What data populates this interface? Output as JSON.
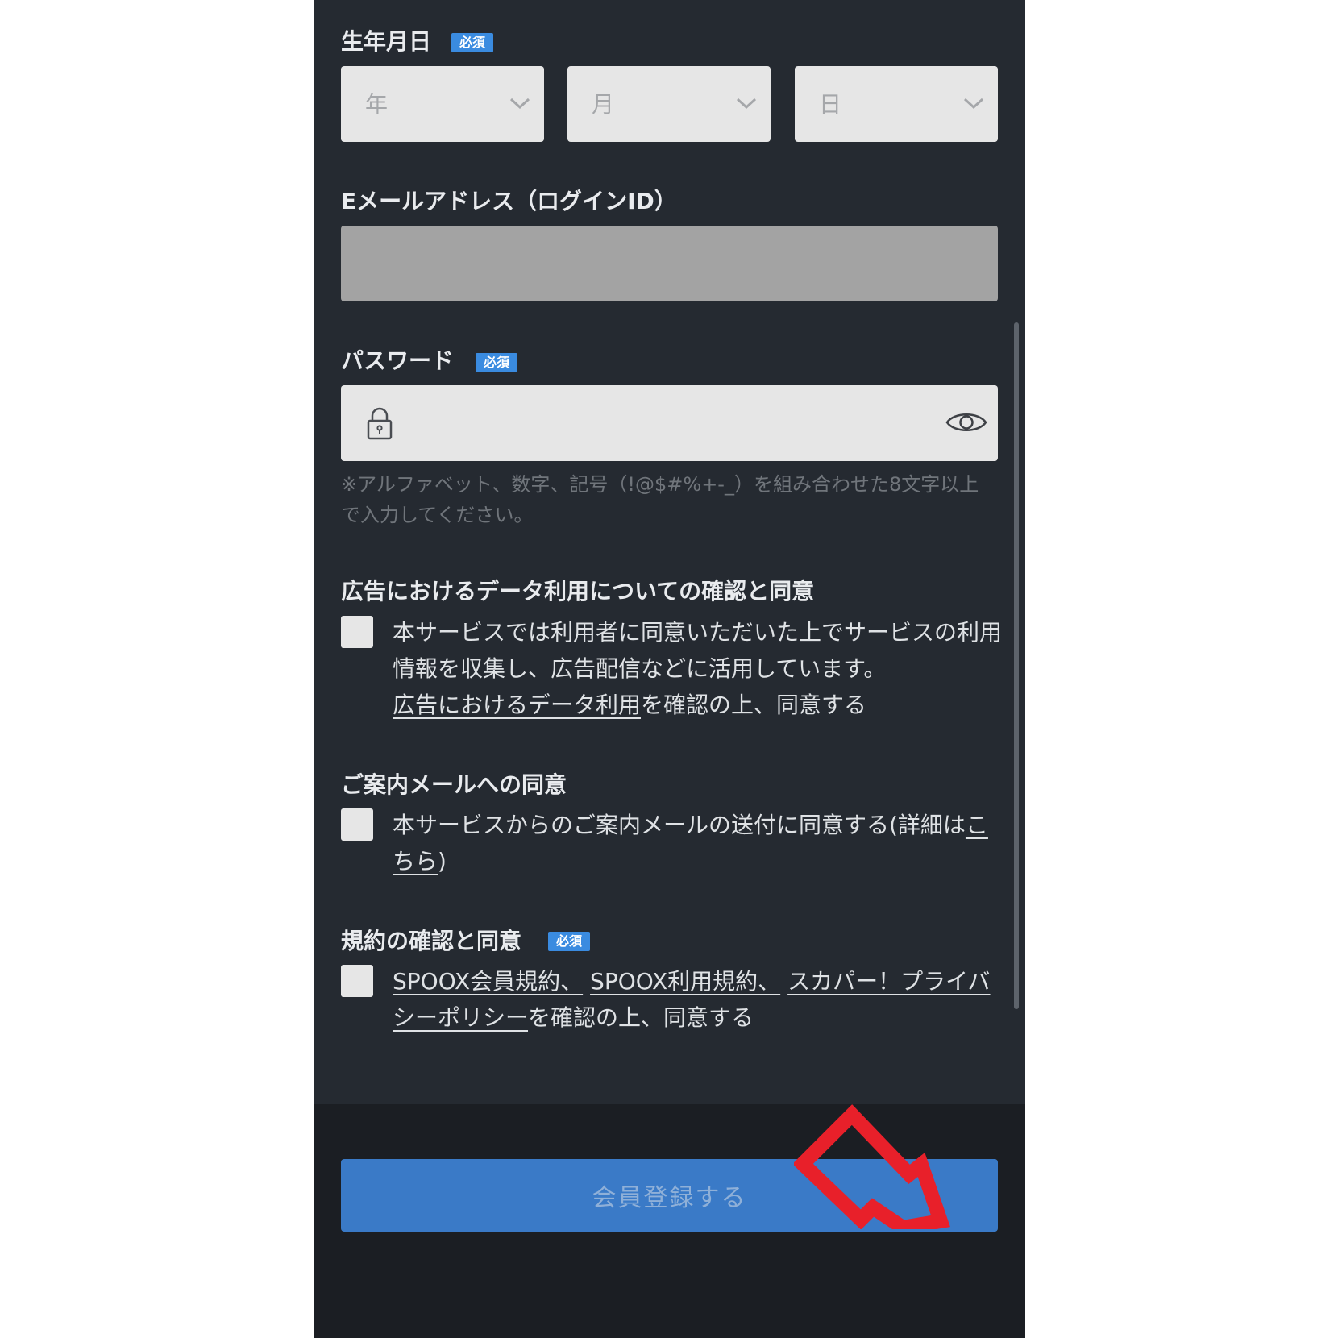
{
  "birthdate": {
    "label": "生年月日",
    "required_badge": "必須",
    "year_placeholder": "年",
    "month_placeholder": "月",
    "day_placeholder": "日"
  },
  "email": {
    "label": "Eメールアドレス（ログインID）"
  },
  "password": {
    "label": "パスワード",
    "required_badge": "必須",
    "hint": "※アルファベット、数字、記号（!@$#%+-_）を組み合わせた8文字以上で入力してください。"
  },
  "ad_consent": {
    "label": "広告におけるデータ利用についての確認と同意",
    "text": "本サービスでは利用者に同意いただいた上でサービスの利用情報を収集し、広告配信などに活用しています。",
    "link": "広告におけるデータ利用",
    "suffix": "を確認の上、同意する"
  },
  "mail_consent": {
    "label": "ご案内メールへの同意",
    "text": "本サービスからのご案内メールの送付に同意する(詳細は",
    "link": "こちら",
    "suffix": ")"
  },
  "terms_consent": {
    "label": "規約の確認と同意",
    "required_badge": "必須",
    "link1": "SPOOX会員規約、",
    "link2": "SPOOX利用規約、",
    "link3": "スカパー！プライバシーポリシー",
    "suffix": "を確認の上、同意する"
  },
  "register_button": "会員登録する",
  "colors": {
    "background": "#252a31",
    "footer": "#1b1e23",
    "accent": "#3a7ac7",
    "badge": "#3a8be0",
    "annotation_arrow": "#e8202a"
  }
}
